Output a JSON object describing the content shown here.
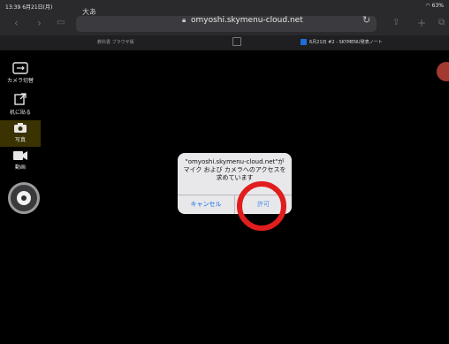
{
  "status_bar": {
    "time": "13:39  6月21日(月)",
    "battery": "63%"
  },
  "browser": {
    "reader_label": "大あ",
    "url": "omyoshi.skymenu-cloud.net",
    "tabs": [
      {
        "label": "教科書 ブラウザ版",
        "active": false
      },
      {
        "label": "6月21日 #2 - SKYMENU発表ノート",
        "active": true
      }
    ]
  },
  "sidebar": {
    "items": [
      {
        "label": "カメラ切替",
        "icon": "camera-switch-icon"
      },
      {
        "label": "机に貼る",
        "icon": "board-paste-icon"
      },
      {
        "label": "写真",
        "icon": "camera-icon",
        "selected": true
      },
      {
        "label": "動画",
        "icon": "video-icon"
      }
    ]
  },
  "dialog": {
    "message": "\"omyoshi.skymenu-cloud.net\"がマイク および カメラへのアクセスを求めています",
    "cancel_label": "キャンセル",
    "allow_label": "許可"
  },
  "colors": {
    "highlight_ring": "#e11d1d",
    "accent": "#0a6ae6"
  }
}
